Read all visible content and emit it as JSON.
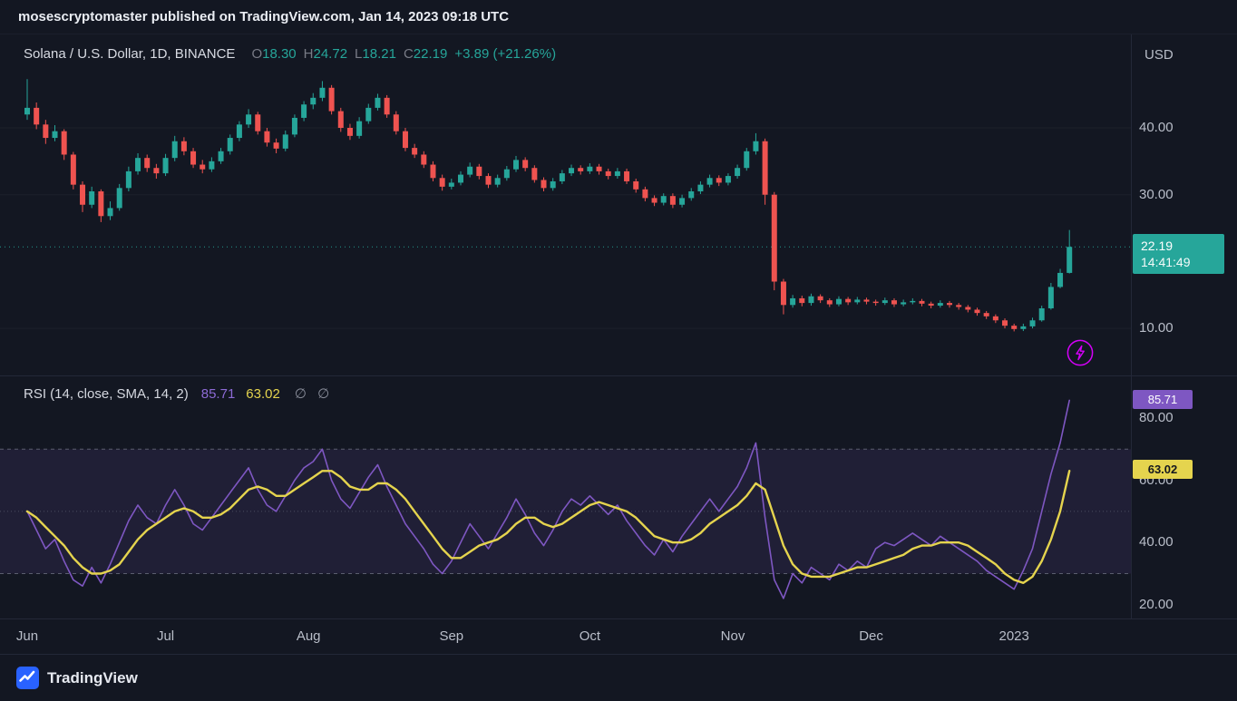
{
  "header": {
    "publish_info": "mosescryptomaster published on TradingView.com, Jan 14, 2023 09:18 UTC"
  },
  "price_pane": {
    "legend": {
      "symbol": "Solana / U.S. Dollar, 1D, BINANCE",
      "ohlc": [
        {
          "label": "O",
          "value": "18.30"
        },
        {
          "label": "H",
          "value": "24.72"
        },
        {
          "label": "L",
          "value": "18.21"
        },
        {
          "label": "C",
          "value": "22.19"
        }
      ],
      "change": "+3.89 (+21.26%)"
    },
    "scale": {
      "currency": "USD",
      "badge_price": "22.19",
      "badge_countdown": "14:41:49"
    }
  },
  "rsi_pane": {
    "legend": {
      "title": "RSI (14, close, SMA, 14, 2)",
      "rsi_value": "85.71",
      "ma_value": "63.02",
      "icons": "∅ ∅"
    },
    "scale": {
      "rsi_badge": "85.71",
      "ma_badge": "63.02"
    }
  },
  "footer": {
    "brand": "TradingView"
  },
  "colors": {
    "background": "#131722",
    "up": "#26a69a",
    "down": "#ef5350",
    "rsi_line": "#7e57c2",
    "rsi_ma_line": "#e5d44e",
    "boost": "#d500f9",
    "brand_blue": "#2962ff",
    "axis_text": "#b9bec9"
  },
  "chart_data": [
    {
      "type": "candlestick",
      "title": "Solana / U.S. Dollar, 1D, BINANCE",
      "ylabel": "USD",
      "ylim": [
        3,
        54
      ],
      "y_ticks": [
        40,
        30,
        10
      ],
      "last": {
        "open": 18.3,
        "high": 24.72,
        "low": 18.21,
        "close": 22.19,
        "change": "+3.89",
        "change_pct": "+21.26%"
      },
      "x_labels": [
        {
          "label": "Jun",
          "i": 0
        },
        {
          "label": "Jul",
          "i": 15
        },
        {
          "label": "Aug",
          "i": 30.5
        },
        {
          "label": "Sep",
          "i": 46
        },
        {
          "label": "Oct",
          "i": 61
        },
        {
          "label": "Nov",
          "i": 76.5
        },
        {
          "label": "Dec",
          "i": 91.5
        },
        {
          "label": "2023",
          "i": 107
        }
      ],
      "candles": [
        [
          42.0,
          47.3,
          41.2,
          43.0
        ],
        [
          43.0,
          43.8,
          39.8,
          40.5
        ],
        [
          40.5,
          41.2,
          37.6,
          38.5
        ],
        [
          38.5,
          40.4,
          38.0,
          39.5
        ],
        [
          39.5,
          39.8,
          35.2,
          36.0
        ],
        [
          36.0,
          36.4,
          30.8,
          31.5
        ],
        [
          31.5,
          32.0,
          27.4,
          28.5
        ],
        [
          28.5,
          31.2,
          28.0,
          30.5
        ],
        [
          30.5,
          30.8,
          25.9,
          26.8
        ],
        [
          26.8,
          29.0,
          26.2,
          28.0
        ],
        [
          28.0,
          31.6,
          27.6,
          31.0
        ],
        [
          31.0,
          34.2,
          30.5,
          33.5
        ],
        [
          33.5,
          36.2,
          33.0,
          35.5
        ],
        [
          35.5,
          36.0,
          33.4,
          34.0
        ],
        [
          34.0,
          34.6,
          32.4,
          33.2
        ],
        [
          33.2,
          36.1,
          32.8,
          35.5
        ],
        [
          35.5,
          38.8,
          35.0,
          38.0
        ],
        [
          38.0,
          38.6,
          35.9,
          36.5
        ],
        [
          36.5,
          37.0,
          34.0,
          34.5
        ],
        [
          34.5,
          35.2,
          33.2,
          33.8
        ],
        [
          33.8,
          35.6,
          33.4,
          35.0
        ],
        [
          35.0,
          37.0,
          34.6,
          36.5
        ],
        [
          36.5,
          39.0,
          36.0,
          38.5
        ],
        [
          38.5,
          41.0,
          38.0,
          40.5
        ],
        [
          40.5,
          42.8,
          40.0,
          42.0
        ],
        [
          42.0,
          42.4,
          39.0,
          39.5
        ],
        [
          39.5,
          40.0,
          37.2,
          37.8
        ],
        [
          37.8,
          38.4,
          36.2,
          36.9
        ],
        [
          36.9,
          39.6,
          36.5,
          39.0
        ],
        [
          39.0,
          42.0,
          38.6,
          41.5
        ],
        [
          41.5,
          44.0,
          41.0,
          43.5
        ],
        [
          43.5,
          45.2,
          42.8,
          44.5
        ],
        [
          44.5,
          47.0,
          44.0,
          46.0
        ],
        [
          46.0,
          46.4,
          42.0,
          42.5
        ],
        [
          42.5,
          43.0,
          39.4,
          40.0
        ],
        [
          40.0,
          40.6,
          38.2,
          38.8
        ],
        [
          38.8,
          41.6,
          38.4,
          41.0
        ],
        [
          41.0,
          43.6,
          40.6,
          43.0
        ],
        [
          43.0,
          45.1,
          42.6,
          44.5
        ],
        [
          44.5,
          44.9,
          41.5,
          42.0
        ],
        [
          42.0,
          42.5,
          39.0,
          39.5
        ],
        [
          39.5,
          40.0,
          36.5,
          37.0
        ],
        [
          37.0,
          37.6,
          35.5,
          36.0
        ],
        [
          36.0,
          36.5,
          34.0,
          34.5
        ],
        [
          34.5,
          35.0,
          32.0,
          32.5
        ],
        [
          32.5,
          33.0,
          30.6,
          31.2
        ],
        [
          31.2,
          32.4,
          30.8,
          31.8
        ],
        [
          31.8,
          33.5,
          31.4,
          33.0
        ],
        [
          33.0,
          34.8,
          32.6,
          34.2
        ],
        [
          34.2,
          34.6,
          32.3,
          32.8
        ],
        [
          32.8,
          33.2,
          31.0,
          31.5
        ],
        [
          31.5,
          33.0,
          31.1,
          32.5
        ],
        [
          32.5,
          34.3,
          32.1,
          33.8
        ],
        [
          33.8,
          35.8,
          33.4,
          35.2
        ],
        [
          35.2,
          35.6,
          33.5,
          34.0
        ],
        [
          34.0,
          34.4,
          31.8,
          32.2
        ],
        [
          32.2,
          32.6,
          30.5,
          31.0
        ],
        [
          31.0,
          32.5,
          30.6,
          32.0
        ],
        [
          32.0,
          33.7,
          31.6,
          33.2
        ],
        [
          33.2,
          34.5,
          32.8,
          34.0
        ],
        [
          34.0,
          34.4,
          33.0,
          33.5
        ],
        [
          33.5,
          34.7,
          33.1,
          34.2
        ],
        [
          34.2,
          34.6,
          33.0,
          33.5
        ],
        [
          33.5,
          33.9,
          32.3,
          32.8
        ],
        [
          32.8,
          34.0,
          32.4,
          33.5
        ],
        [
          33.5,
          33.9,
          31.6,
          32.0
        ],
        [
          32.0,
          32.4,
          30.3,
          30.8
        ],
        [
          30.8,
          31.2,
          29.0,
          29.5
        ],
        [
          29.5,
          29.9,
          28.3,
          28.8
        ],
        [
          28.8,
          30.2,
          28.4,
          29.8
        ],
        [
          29.8,
          30.2,
          28.0,
          28.5
        ],
        [
          28.5,
          30.0,
          28.1,
          29.5
        ],
        [
          29.5,
          31.0,
          29.1,
          30.5
        ],
        [
          30.5,
          32.0,
          30.1,
          31.5
        ],
        [
          31.5,
          33.0,
          31.1,
          32.5
        ],
        [
          32.5,
          32.9,
          31.3,
          31.8
        ],
        [
          31.8,
          33.2,
          31.4,
          32.8
        ],
        [
          32.8,
          34.5,
          32.4,
          34.0
        ],
        [
          34.0,
          37.0,
          33.6,
          36.5
        ],
        [
          36.5,
          39.2,
          36.0,
          38.0
        ],
        [
          38.0,
          38.4,
          28.5,
          30.0
        ],
        [
          30.0,
          30.4,
          15.7,
          17.0
        ],
        [
          17.0,
          17.4,
          12.1,
          13.5
        ],
        [
          13.5,
          15.0,
          13.1,
          14.5
        ],
        [
          14.5,
          14.9,
          13.3,
          13.8
        ],
        [
          13.8,
          15.2,
          13.4,
          14.8
        ],
        [
          14.8,
          15.1,
          13.8,
          14.2
        ],
        [
          14.2,
          14.5,
          13.2,
          13.6
        ],
        [
          13.6,
          14.8,
          13.3,
          14.4
        ],
        [
          14.4,
          14.7,
          13.5,
          13.9
        ],
        [
          13.9,
          14.7,
          13.6,
          14.3
        ],
        [
          14.3,
          14.6,
          13.6,
          14.0
        ],
        [
          14.0,
          14.3,
          13.4,
          13.8
        ],
        [
          13.8,
          14.6,
          13.5,
          14.2
        ],
        [
          14.2,
          14.5,
          13.2,
          13.6
        ],
        [
          13.6,
          14.3,
          13.3,
          13.9
        ],
        [
          13.9,
          14.5,
          13.6,
          14.1
        ],
        [
          14.1,
          14.4,
          13.3,
          13.7
        ],
        [
          13.7,
          14.0,
          13.0,
          13.4
        ],
        [
          13.4,
          14.2,
          13.1,
          13.8
        ],
        [
          13.8,
          14.1,
          13.1,
          13.5
        ],
        [
          13.5,
          13.8,
          12.8,
          13.2
        ],
        [
          13.2,
          13.5,
          12.4,
          12.8
        ],
        [
          12.8,
          13.1,
          11.9,
          12.3
        ],
        [
          12.3,
          12.6,
          11.4,
          11.8
        ],
        [
          11.8,
          12.1,
          10.8,
          11.2
        ],
        [
          11.2,
          11.5,
          10.0,
          10.4
        ],
        [
          10.4,
          10.7,
          9.55,
          9.9
        ],
        [
          9.9,
          10.7,
          9.6,
          10.3
        ],
        [
          10.3,
          11.6,
          10.0,
          11.2
        ],
        [
          11.2,
          13.4,
          11.0,
          13.0
        ],
        [
          13.0,
          16.8,
          12.8,
          16.2
        ],
        [
          16.2,
          18.9,
          16.0,
          18.3
        ],
        [
          18.3,
          24.72,
          18.21,
          22.19
        ]
      ]
    },
    {
      "type": "line",
      "title": "RSI (14, close, SMA, 14, 2)",
      "ylim": [
        15,
        93
      ],
      "y_ticks": [
        80,
        60,
        40,
        20
      ],
      "levels": {
        "overbought": 70,
        "middle": 50,
        "oversold": 30
      },
      "last": {
        "rsi": 85.71,
        "sma": 63.02
      },
      "series": [
        {
          "name": "RSI",
          "color": "#7e57c2",
          "values": [
            50,
            44,
            38,
            41,
            34,
            28,
            26,
            32,
            27,
            33,
            40,
            47,
            52,
            48,
            46,
            52,
            57,
            52,
            46,
            44,
            48,
            52,
            56,
            60,
            64,
            57,
            52,
            50,
            55,
            60,
            64,
            66,
            70,
            60,
            54,
            51,
            56,
            61,
            65,
            58,
            52,
            46,
            42,
            38,
            33,
            30,
            34,
            40,
            46,
            42,
            38,
            43,
            48,
            54,
            49,
            43,
            39,
            44,
            50,
            54,
            52,
            55,
            52,
            49,
            52,
            47,
            43,
            39,
            36,
            41,
            37,
            42,
            46,
            50,
            54,
            50,
            54,
            58,
            64,
            72,
            48,
            28,
            22,
            30,
            27,
            32,
            30,
            28,
            33,
            31,
            34,
            32,
            38,
            40,
            39,
            41,
            43,
            41,
            39,
            42,
            40,
            38,
            36,
            34,
            31,
            29,
            27,
            25,
            31,
            38,
            50,
            62,
            72,
            85.71
          ]
        },
        {
          "name": "SMA",
          "color": "#e5d44e",
          "values": [
            50,
            48,
            45,
            42,
            39,
            35,
            32,
            30,
            30,
            31,
            33,
            37,
            41,
            44,
            46,
            48,
            50,
            51,
            50,
            48,
            48,
            49,
            51,
            54,
            57,
            58,
            57,
            55,
            55,
            57,
            59,
            61,
            63,
            63,
            61,
            58,
            57,
            57,
            59,
            59,
            57,
            54,
            50,
            46,
            42,
            38,
            35,
            35,
            37,
            39,
            40,
            41,
            43,
            46,
            48,
            48,
            46,
            45,
            46,
            48,
            50,
            52,
            53,
            52,
            51,
            50,
            48,
            45,
            42,
            41,
            40,
            40,
            41,
            43,
            46,
            48,
            50,
            52,
            55,
            59,
            57,
            48,
            39,
            33,
            30,
            29,
            29,
            29,
            30,
            31,
            32,
            32,
            33,
            34,
            35,
            36,
            38,
            39,
            39,
            40,
            40,
            40,
            39,
            37,
            35,
            33,
            30,
            28,
            27,
            29,
            34,
            41,
            50,
            63.02
          ]
        }
      ]
    }
  ]
}
